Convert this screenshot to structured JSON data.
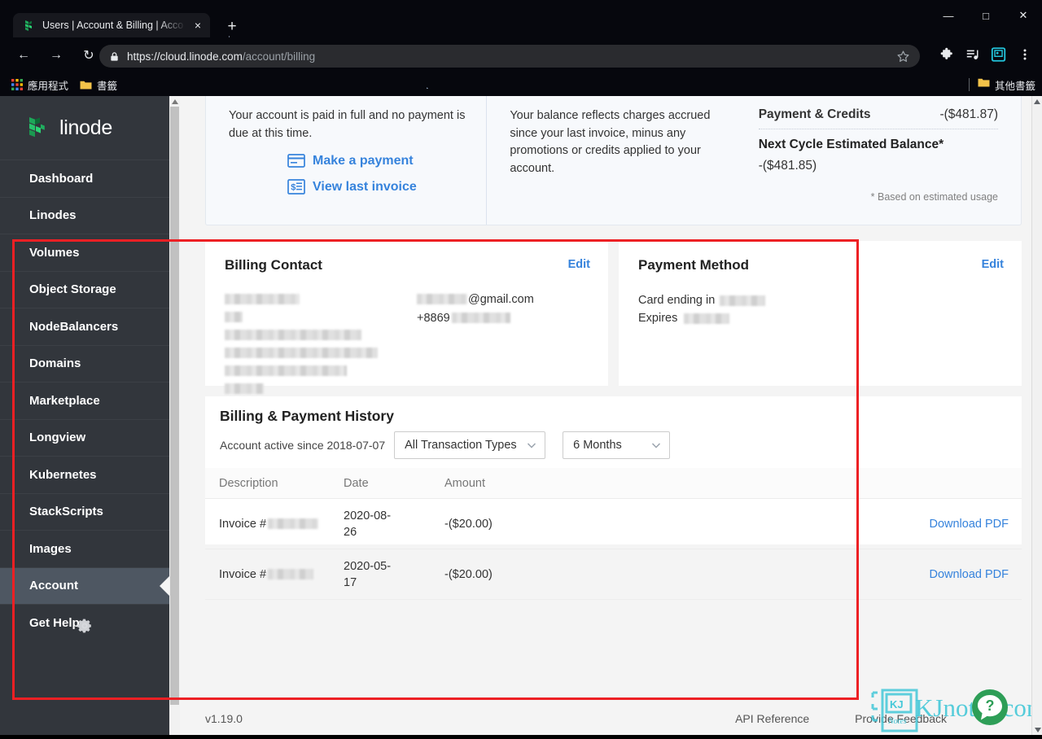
{
  "browser": {
    "tab": {
      "title": "Users | Account & Billing | Acco",
      "favicon": "linode-favicon",
      "close": "×"
    },
    "new_tab": "+",
    "window_controls": {
      "minimize": "—",
      "maximize": "□",
      "close": "✕"
    },
    "nav": {
      "back": "←",
      "forward": "→",
      "reload": "↻"
    },
    "url": {
      "scheme_host": "https://cloud.linode.com",
      "path": "/account/billing",
      "lock": "lock-icon"
    },
    "toolbar_icons": [
      "bookmark-star-icon",
      "extensions-puzzle-icon",
      "media-list-icon",
      "profile-icon",
      "menu-icon"
    ],
    "bookmarks": [
      {
        "label": "應用程式",
        "icon": "apps-grid-icon"
      },
      {
        "label": "書籤",
        "icon": "folder-icon"
      }
    ],
    "bookmarks_right": {
      "label": "其他書籤",
      "icon": "folder-icon"
    }
  },
  "sidebar": {
    "brand": "linode",
    "items": [
      {
        "label": "Dashboard",
        "active": false
      },
      {
        "label": "Linodes",
        "active": false
      },
      {
        "label": "Volumes",
        "active": false
      },
      {
        "label": "Object Storage",
        "active": false
      },
      {
        "label": "NodeBalancers",
        "active": false
      },
      {
        "label": "Domains",
        "active": false
      },
      {
        "label": "Marketplace",
        "active": false
      },
      {
        "label": "Longview",
        "active": false
      },
      {
        "label": "Kubernetes",
        "active": false
      },
      {
        "label": "StackScripts",
        "active": false
      },
      {
        "label": "Images",
        "active": false
      },
      {
        "label": "Account",
        "active": true
      },
      {
        "label": "Get Help",
        "active": false
      }
    ],
    "settings_icon": "gear-icon"
  },
  "summary": {
    "paid_text": "Your account is paid in full and no payment is due at this time.",
    "make_payment": "Make a payment",
    "view_invoice": "View last invoice",
    "balance_text": "Your balance reflects charges accrued since your last invoice, minus any promotions or credits applied to your account.",
    "payment_credits_label": "Payment & Credits",
    "payment_credits_value": "-($481.87)",
    "next_cycle_label": "Next Cycle Estimated Balance*",
    "next_cycle_value": "-($481.85)",
    "note": "* Based on estimated usage"
  },
  "billing_contact": {
    "title": "Billing Contact",
    "edit": "Edit",
    "city_state": "Taichung, Taichung",
    "email_suffix": "@gmail.com",
    "phone_prefix": "+8869",
    "redacted": true
  },
  "payment_method": {
    "title": "Payment Method",
    "edit": "Edit",
    "card_label": "Card ending in",
    "expires_label": "Expires",
    "redacted": true
  },
  "history": {
    "title": "Billing & Payment History",
    "since": "Account active since 2018-07-07",
    "transaction_type_value": "All Transaction Types",
    "date_range_value": "6 Months",
    "columns": [
      "Description",
      "Date",
      "Amount",
      ""
    ],
    "rows": [
      {
        "description_prefix": "Invoice #",
        "description_redacted": true,
        "date": "2020-08-26",
        "amount": "-($20.00)",
        "action": "Download PDF"
      },
      {
        "description_prefix": "Invoice #",
        "description_redacted": true,
        "date": "2020-05-17",
        "amount": "-($20.00)",
        "action": "Download PDF"
      }
    ]
  },
  "footer": {
    "version": "v1.19.0",
    "api_reference": "API Reference",
    "provide_feedback": "Provide Feedback"
  },
  "overlay": {
    "watermark_text": "KJnotes.com",
    "watermark_logo": "KJ",
    "watermark_sub": "Notes",
    "help_button": "?",
    "highlight_color": "#ed2024",
    "accent_color": "#3683dc",
    "watermark_color": "#44c8d8",
    "help_color": "#2e9e57"
  }
}
